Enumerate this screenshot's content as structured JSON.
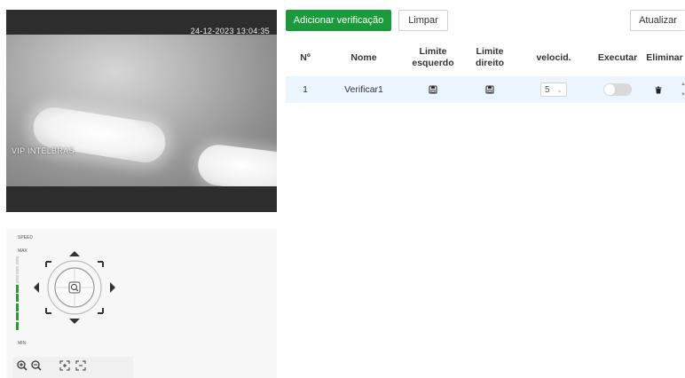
{
  "camera": {
    "osd_datetime": "24-12-2023 13:04:35",
    "osd_name": "VIP INTELBRAS"
  },
  "ptz": {
    "speed_label": "SPEED",
    "max_label": "MAX",
    "min_label": "MIN",
    "speed_level": 5,
    "speed_levels_total": 8,
    "zoom_in_icon": "zoom-in-icon",
    "zoom_out_icon": "zoom-out-icon",
    "focus_near_icon": "focus-near-icon",
    "focus_far_icon": "focus-far-icon"
  },
  "toolbar": {
    "add_label": "Adicionar verificação",
    "clear_label": "Limpar",
    "refresh_label": "Atualizar"
  },
  "table": {
    "headers": [
      "Nº",
      "Nome",
      "Limite esquerdo",
      "Limite direito",
      "velocid.",
      "Executar",
      "Eliminar"
    ],
    "rows": [
      {
        "num": "1",
        "name": "Verificar1",
        "speed": "5",
        "run": false
      }
    ]
  },
  "colors": {
    "primary": "#1a9a3a",
    "row_highlight": "#eaf5fd",
    "speed_on": "#2a9a36"
  }
}
